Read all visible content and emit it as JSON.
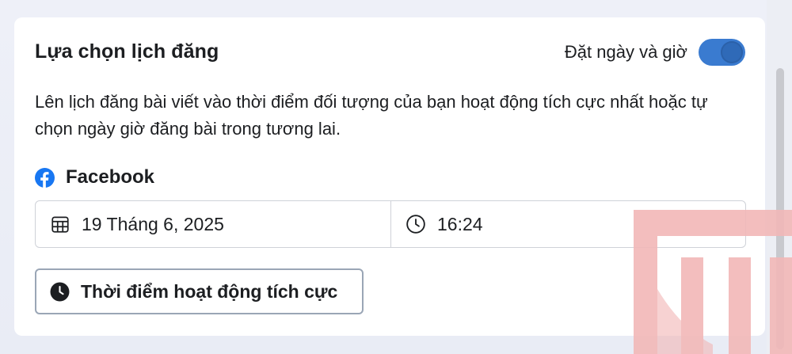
{
  "card": {
    "title": "Lựa chọn lịch đăng",
    "toggle": {
      "label": "Đặt ngày và giờ",
      "on": true,
      "color": "#3a7bd0"
    },
    "description": "Lên lịch đăng bài viết vào thời điểm đối tượng của bạn hoạt động tích cực nhất hoặc tự chọn ngày giờ đăng bài trong tương lai."
  },
  "platform": {
    "icon": "facebook-icon",
    "name": "Facebook",
    "color": "#1877f2"
  },
  "schedule": {
    "date": {
      "icon": "calendar-icon",
      "value": "19 Tháng 6, 2025"
    },
    "time": {
      "icon": "clock-icon",
      "value": "16:24"
    }
  },
  "active_times_button": {
    "icon": "clock-filled-icon",
    "label": "Thời điểm hoạt động tích cực"
  }
}
